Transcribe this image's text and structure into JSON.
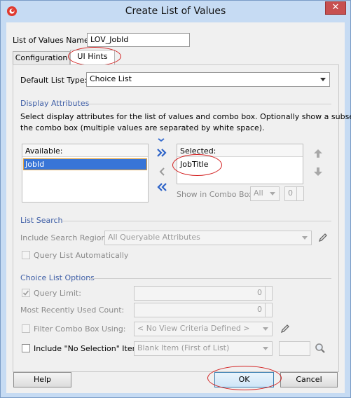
{
  "window": {
    "title": "Create List of Values",
    "close_glyph": "✕"
  },
  "lov_name": {
    "label": "List of Values Name:",
    "value": "LOV_JobId"
  },
  "tabs": [
    {
      "label": "Configuration"
    },
    {
      "label": "UI Hints"
    }
  ],
  "default_list_type": {
    "label": "Default List Type:",
    "value": "Choice List"
  },
  "display_attributes": {
    "title": "Display Attributes",
    "description_line1": "Select display attributes for the list of values and combo box. Optionally show a subset in",
    "description_line2": "the combo box (multiple values are separated by white space).",
    "available_header": "Available:",
    "available_items": [
      "JobId"
    ],
    "selected_header": "Selected:",
    "selected_items": [
      "JobTitle"
    ],
    "show_in_combo_label": "Show in Combo Box:",
    "show_in_combo_value": "All",
    "show_in_combo_count": "0"
  },
  "list_search": {
    "title": "List Search",
    "include_search_region_label": "Include Search Region:",
    "include_search_region_value": "All Queryable Attributes",
    "query_automatically_label": "Query List Automatically"
  },
  "choice_list_options": {
    "title": "Choice List Options",
    "query_limit_label": "Query Limit:",
    "query_limit_value": "0",
    "mru_label": "Most Recently Used Count:",
    "mru_value": "0",
    "filter_label": "Filter Combo Box Using:",
    "filter_value": "< No View Criteria Defined >",
    "no_selection_label": "Include \"No Selection\" Item:",
    "no_selection_value": "Blank Item (First of List)"
  },
  "buttons": {
    "help": "Help",
    "ok": "OK",
    "cancel": "Cancel"
  },
  "colors": {
    "accent": "#3e5ea6",
    "selection": "#3875d7",
    "annotation": "#d32020"
  }
}
